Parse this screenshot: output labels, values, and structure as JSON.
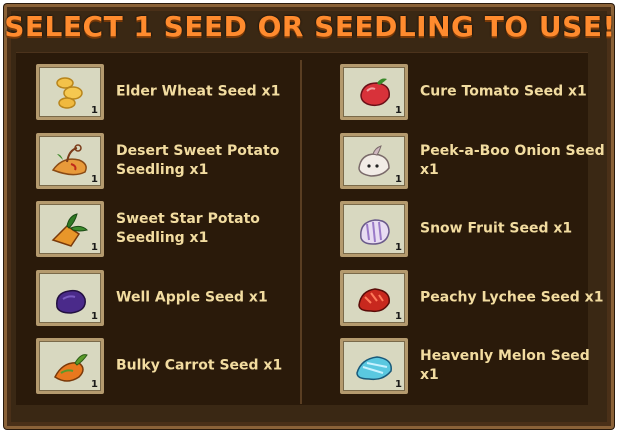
{
  "title": "SELECT 1 SEED OR SEEDLING TO USE!",
  "left_items": [
    {
      "name": "Elder Wheat Seed x1",
      "qty": "1",
      "icon": "wheat-seed-icon"
    },
    {
      "name": "Desert Sweet Potato Seedling x1",
      "qty": "1",
      "icon": "sweet-potato-seedling-icon"
    },
    {
      "name": "Sweet Star Potato Seedling x1",
      "qty": "1",
      "icon": "star-potato-seedling-icon"
    },
    {
      "name": "Well Apple Seed x1",
      "qty": "1",
      "icon": "apple-seed-icon"
    },
    {
      "name": "Bulky Carrot Seed x1",
      "qty": "1",
      "icon": "carrot-seed-icon"
    }
  ],
  "right_items": [
    {
      "name": "Cure Tomato Seed x1",
      "qty": "1",
      "icon": "tomato-seed-icon"
    },
    {
      "name": "Peek-a-Boo Onion Seed x1",
      "qty": "1",
      "icon": "onion-seed-icon"
    },
    {
      "name": "Snow Fruit Seed x1",
      "qty": "1",
      "icon": "snow-fruit-seed-icon"
    },
    {
      "name": "Peachy Lychee Seed x1",
      "qty": "1",
      "icon": "lychee-seed-icon"
    },
    {
      "name": "Heavenly Melon Seed x1",
      "qty": "1",
      "icon": "melon-seed-icon"
    }
  ],
  "colors": {
    "title": "#ff8b2e",
    "label": "#f2dca0",
    "panel": "#2a1a0a",
    "slot": "#d8d8c0"
  }
}
